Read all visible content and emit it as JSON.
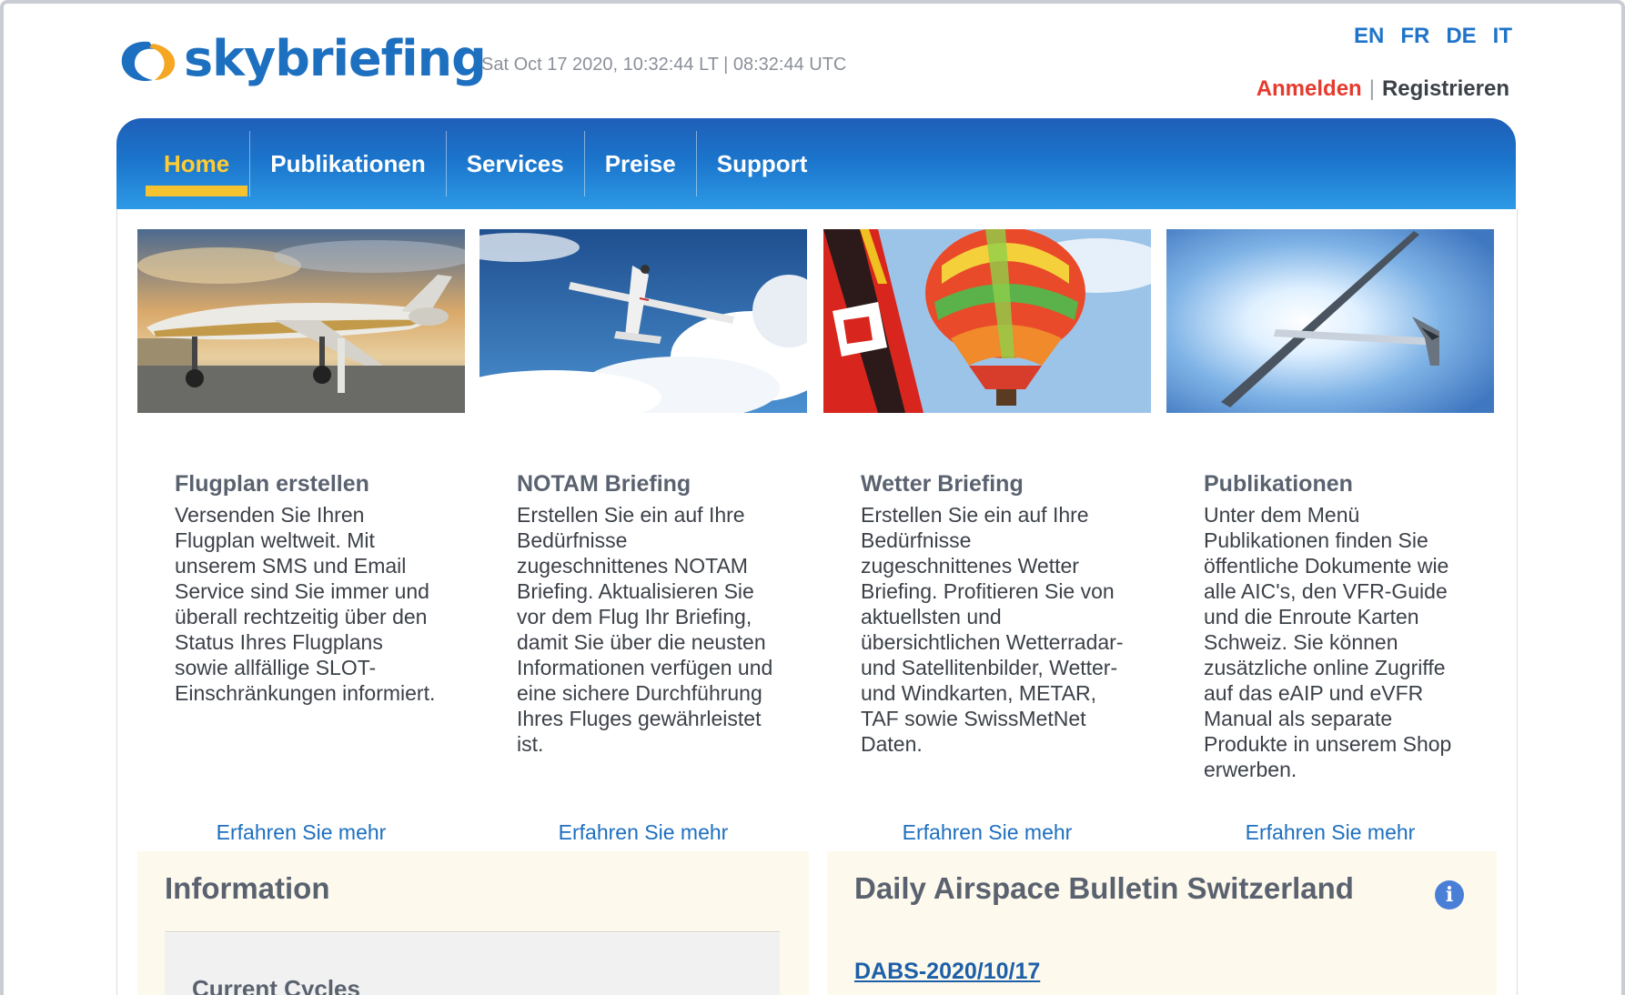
{
  "header": {
    "logo_text": "skybriefing",
    "datetime": "Sat Oct 17 2020, 10:32:44 LT | 08:32:44 UTC",
    "languages": [
      "EN",
      "FR",
      "DE",
      "IT"
    ],
    "login": "Anmelden",
    "separator": "|",
    "register": "Registrieren"
  },
  "nav": {
    "items": [
      "Home",
      "Publikationen",
      "Services",
      "Preise",
      "Support"
    ],
    "active": "Home",
    "active_color": "#ffcc33"
  },
  "cards": [
    {
      "image": "business-jet-photo",
      "title": "Flugplan erstellen",
      "text": "Versenden Sie Ihren Flugplan weltweit. Mit unserem SMS und Email Service sind Sie immer und überall rechtzeitig über den Status Ihres Flugplans sowie allfällige SLOT-Einschränkungen informiert.",
      "link": "Erfahren Sie mehr"
    },
    {
      "image": "small-plane-sky-photo",
      "title": "NOTAM Briefing",
      "text": "Erstellen Sie ein auf Ihre Bedürfnisse zugeschnittenes NOTAM Briefing. Aktualisieren Sie vor dem Flug Ihr Briefing, damit Sie über die neusten Informationen verfügen und eine sichere Durchführung Ihres Fluges gewährleistet ist.",
      "link": "Erfahren Sie mehr"
    },
    {
      "image": "hot-air-balloon-photo",
      "title": "Wetter Briefing",
      "text": "Erstellen Sie ein auf Ihre Bedürfnisse zugeschnittenes Wetter Briefing. Profitieren Sie von aktuellsten und übersichtlichen Wetterradar- und Satellitenbilder, Wetter- und Windkarten, METAR, TAF sowie SwissMetNet Daten.",
      "link": "Erfahren Sie mehr"
    },
    {
      "image": "glider-photo",
      "title": "Publikationen",
      "text": "Unter dem Menü Publikationen finden Sie öffentliche Dokumente wie alle AIC's, den VFR-Guide und die Enroute Karten Schweiz. Sie können zusätzliche online Zugriffe auf das eAIP und eVFR Manual als separate Produkte in unserem Shop erwerben.",
      "link": "Erfahren Sie mehr"
    }
  ],
  "info_panel": {
    "title": "Information",
    "subtitle": "Current Cycles"
  },
  "dabs_panel": {
    "title": "Daily Airspace Bulletin Switzerland",
    "info_icon": "i",
    "link": "DABS-2020/10/17"
  },
  "colors": {
    "brand_blue": "#1d6fbf",
    "login_red": "#e53a2d",
    "panel_bg": "#fdf9ec"
  }
}
